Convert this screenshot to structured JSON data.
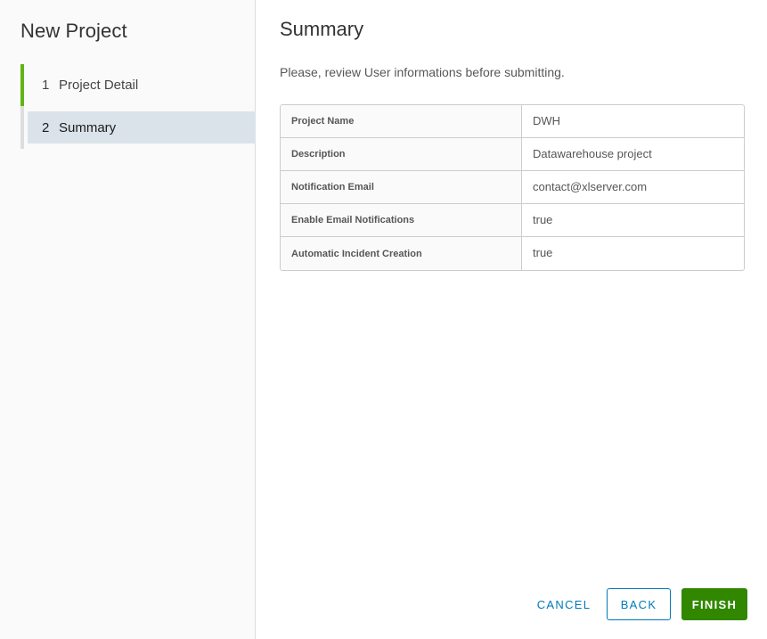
{
  "wizard": {
    "title": "New Project",
    "steps": [
      {
        "number": "1",
        "label": "Project Detail",
        "state": "completed"
      },
      {
        "number": "2",
        "label": "Summary",
        "state": "active"
      }
    ]
  },
  "main": {
    "title": "Summary",
    "subtitle": "Please, review User informations before submitting.",
    "rows": [
      {
        "key": "Project Name",
        "value": "DWH"
      },
      {
        "key": "Description",
        "value": "Datawarehouse project"
      },
      {
        "key": "Notification Email",
        "value": "contact@xlserver.com"
      },
      {
        "key": "Enable Email Notifications",
        "value": "true"
      },
      {
        "key": "Automatic Incident Creation",
        "value": "true"
      }
    ]
  },
  "footer": {
    "cancel_label": "CANCEL",
    "back_label": "BACK",
    "finish_label": "FINISH"
  },
  "colors": {
    "step_completed_bar": "#60b515",
    "step_active_bg": "#dae3ea",
    "primary_link": "#0079b8",
    "finish_button": "#318700"
  }
}
